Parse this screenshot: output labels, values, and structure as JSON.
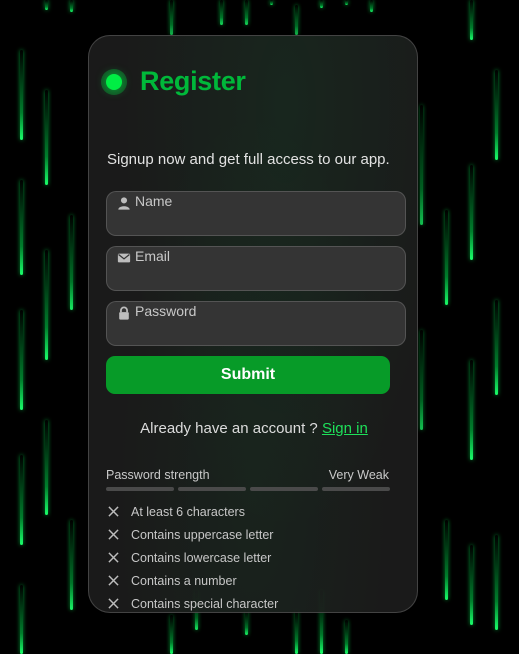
{
  "form": {
    "title": "Register",
    "subtitle": "Signup now and get full access to our app.",
    "fields": [
      {
        "label": "Name",
        "icon": "user-icon",
        "value": ""
      },
      {
        "label": "Email",
        "icon": "mail-icon",
        "value": ""
      },
      {
        "label": "Password",
        "icon": "lock-icon",
        "value": ""
      }
    ],
    "submit_label": "Submit",
    "signin_prompt": "Already have an account ?",
    "signin_link": "Sign in"
  },
  "password_strength": {
    "label": "Password strength",
    "value": "Very Weak",
    "segments_filled": 0,
    "segments_total": 4,
    "criteria": [
      "At least 6 characters",
      "Contains uppercase letter",
      "Contains lowercase letter",
      "Contains a number",
      "Contains special character"
    ]
  },
  "colors": {
    "accent": "#00b83a",
    "button": "#079b28",
    "link": "#1ee05a",
    "rain": "#1aff6a",
    "background": "#000000"
  }
}
